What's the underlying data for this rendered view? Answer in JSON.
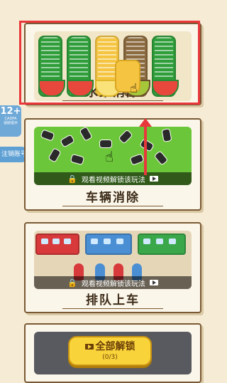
{
  "side": {
    "age_rating": "12+",
    "age_small_1": "CADPA",
    "age_small_2": "适龄提示",
    "login_tag": "注销账号"
  },
  "levels": [
    {
      "title": "水果消除",
      "locked": false
    },
    {
      "title": "车辆消除",
      "locked": true,
      "overlay_text": "观看视频解锁该玩法"
    },
    {
      "title": "排队上车",
      "locked": true,
      "overlay_text": "观看视频解锁该玩法"
    },
    {
      "title": "",
      "locked": true
    }
  ],
  "unlock_all": {
    "label": "全部解锁",
    "progress": "(0/3)"
  },
  "colors": {
    "highlight": "#e8383b",
    "button": "#f9d33a"
  },
  "icons": [
    "lock-icon",
    "video-icon",
    "pointer-hand-icon",
    "arrow-up-icon"
  ]
}
